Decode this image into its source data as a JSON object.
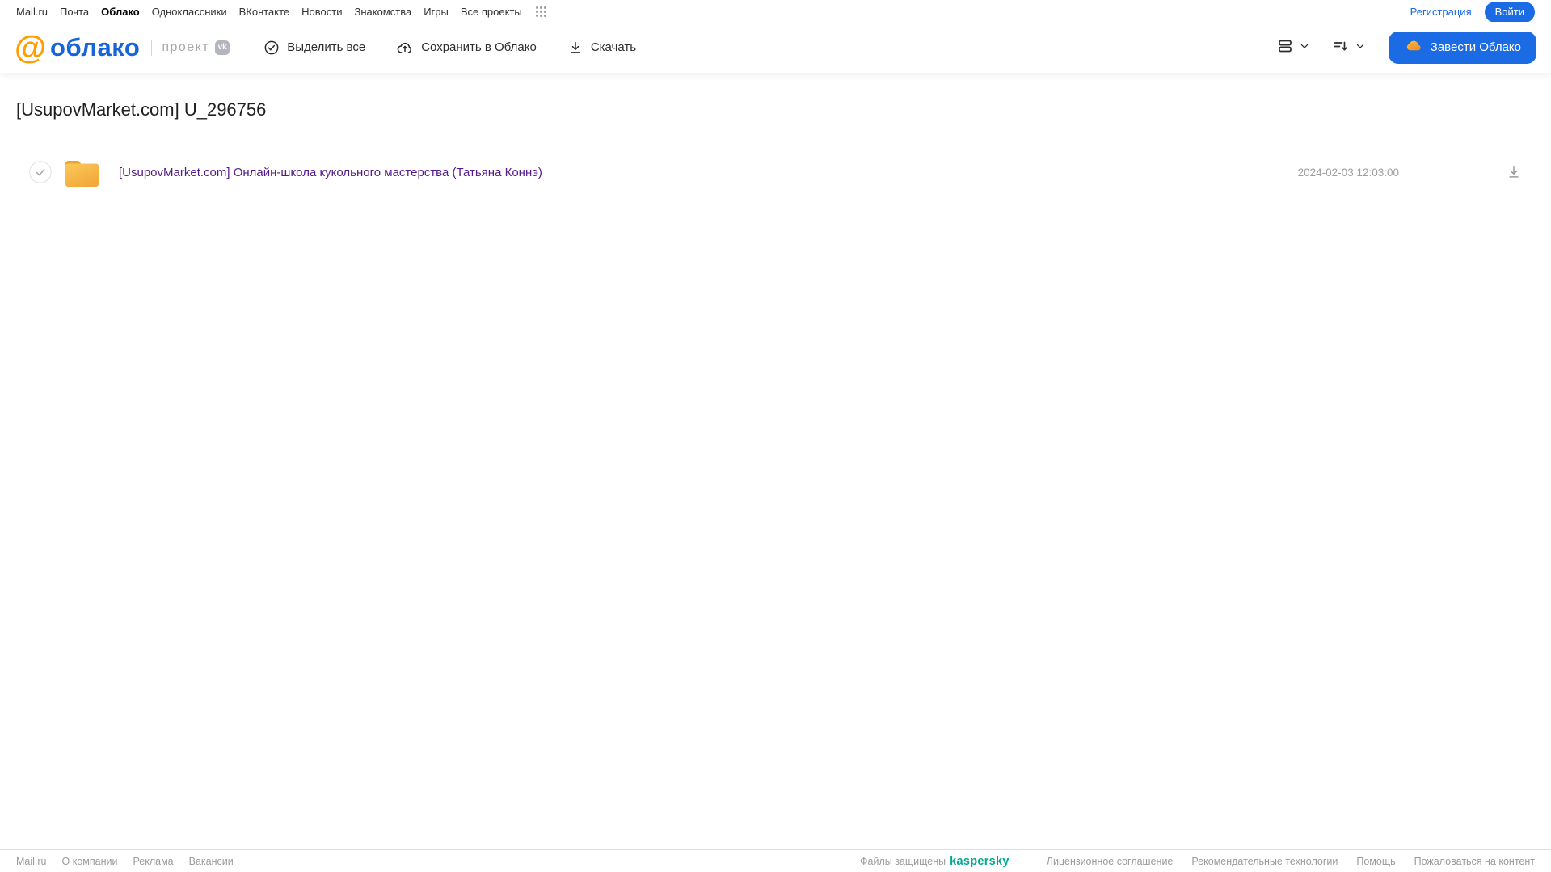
{
  "top_nav": {
    "items": [
      "Mail.ru",
      "Почта",
      "Облако",
      "Одноклассники",
      "ВКонтакте",
      "Новости",
      "Знакомства",
      "Игры",
      "Все проекты"
    ],
    "active_item": "Облако",
    "registration_label": "Регистрация",
    "login_label": "Войти"
  },
  "header": {
    "logo_at": "@",
    "logo_text": "облако",
    "project_label": "проект",
    "vk_badge_text": "vk",
    "toolbar": {
      "select_all_label": "Выделить все",
      "save_to_cloud_label": "Сохранить в Облако",
      "download_label": "Скачать"
    },
    "get_cloud_label": "Завести Облако"
  },
  "main": {
    "title": "[UsupovMarket.com] U_296756",
    "files": [
      {
        "type": "folder",
        "name": "[UsupovMarket.com] Онлайн-школа кукольного мастерства (Татьяна Коннэ)",
        "date": "2024-02-03 12:03:00"
      }
    ]
  },
  "footer": {
    "left_links": [
      "Mail.ru",
      "О компании",
      "Реклама",
      "Вакансии"
    ],
    "protected_label": "Файлы защищены",
    "kaspersky_label": "kaspersky",
    "right_links": [
      "Лицензионное соглашение",
      "Рекомендательные технологии",
      "Помощь",
      "Пожаловаться на контент"
    ]
  },
  "colors": {
    "accent_blue": "#1b6be5",
    "logo_blue": "#1764d8",
    "logo_orange": "#ff9e00",
    "folder_yellow": "#f6b73c",
    "visited_link_purple": "#551a8b",
    "kaspersky_teal": "#00a88e",
    "muted_gray": "#9b9b9b"
  }
}
